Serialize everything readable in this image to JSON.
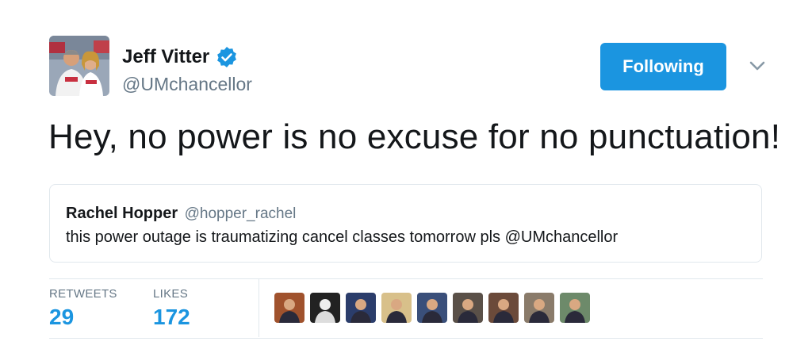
{
  "author": {
    "name": "Jeff Vitter",
    "handle": "@UMchancellor",
    "verified": true,
    "avatar_icon": "user-avatar-photo"
  },
  "follow_button": {
    "label": "Following",
    "color": "#1b95e0"
  },
  "more_menu_icon": "chevron-down-icon",
  "tweet_text": "Hey, no power is no excuse for no punctuation!",
  "quoted_tweet": {
    "name": "Rachel Hopper",
    "handle": "@hopper_rachel",
    "text": "this power outage is traumatizing cancel classes tomorrow pls @UMchancellor"
  },
  "stats": {
    "retweets_label": "RETWEETS",
    "retweets_value": "29",
    "likes_label": "LIKES",
    "likes_value": "172"
  },
  "likers": [
    {
      "icon": "liker-avatar-1",
      "color": "#a0522d"
    },
    {
      "icon": "liker-avatar-2",
      "color": "#222222"
    },
    {
      "icon": "liker-avatar-3",
      "color": "#2b3d6b"
    },
    {
      "icon": "liker-avatar-4",
      "color": "#d8c08a"
    },
    {
      "icon": "liker-avatar-5",
      "color": "#3a4f7a"
    },
    {
      "icon": "liker-avatar-6",
      "color": "#5a5048"
    },
    {
      "icon": "liker-avatar-7",
      "color": "#6b4a3a"
    },
    {
      "icon": "liker-avatar-8",
      "color": "#8a7b6a"
    },
    {
      "icon": "liker-avatar-9",
      "color": "#6d8a6a"
    }
  ],
  "colors": {
    "accent": "#1b95e0",
    "secondary_text": "#657786",
    "border": "#e1e8ed"
  }
}
